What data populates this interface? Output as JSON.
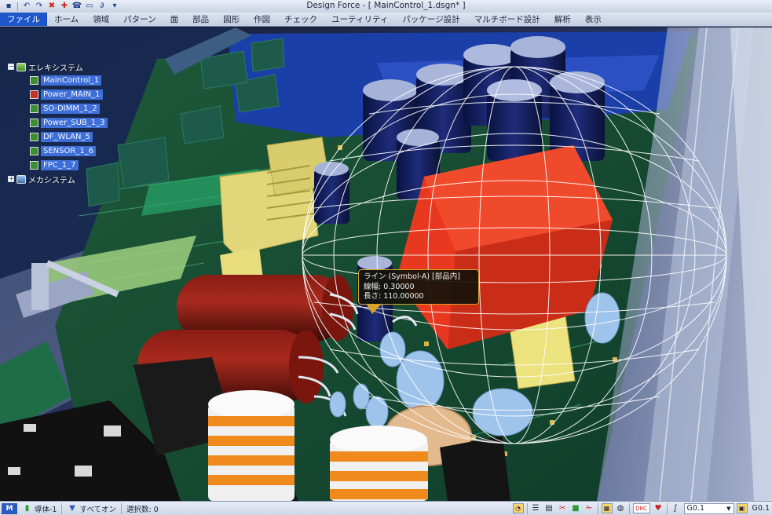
{
  "window": {
    "title": "Design Force - [ MainControl_1.dsgn* ]"
  },
  "quick_access": [
    {
      "name": "save-icon",
      "glyph": "▪"
    },
    {
      "name": "undo-icon",
      "glyph": "↶"
    },
    {
      "name": "redo-icon",
      "glyph": "↷"
    },
    {
      "name": "delete-icon",
      "glyph": "✖"
    },
    {
      "name": "tool-icon",
      "glyph": "✚"
    },
    {
      "name": "phone-icon",
      "glyph": "☎"
    },
    {
      "name": "display-icon",
      "glyph": "▭"
    },
    {
      "name": "route-icon",
      "glyph": "∂"
    },
    {
      "name": "customize-icon",
      "glyph": "▾"
    }
  ],
  "ribbon_tabs": [
    "ファイル",
    "ホーム",
    "領域",
    "パターン",
    "面",
    "部品",
    "図形",
    "作図",
    "チェック",
    "ユーティリティ",
    "パッケージ設計",
    "マルチボード設計",
    "解析",
    "表示"
  ],
  "tree": {
    "root_elec": "エレキシステム",
    "root_mech": "メカシステム",
    "items": [
      "MainControl_1",
      "Power_MAIN_1",
      "SO-DIMM_1_2",
      "Power_SUB_1_3",
      "DF_WLAN_5",
      "SENSOR_1_6",
      "FPC_1_7"
    ]
  },
  "tooltip": {
    "line1": "ライン (Symbol-A) [部品内]",
    "line2": "線幅: 0.30000",
    "line3": "長さ: 110.00000"
  },
  "statusbar": {
    "mode": "M",
    "conductor": "導体-1",
    "filter": "すべてオン",
    "selection": "選択数: 0",
    "grid_value": "G0.1",
    "grid_value_right": "G0.1",
    "drc_label": "DRC"
  },
  "colors": {
    "ribbon_active": "#1c56c8",
    "tooltip_border": "#d9a326",
    "transformer": "#e8381f"
  }
}
